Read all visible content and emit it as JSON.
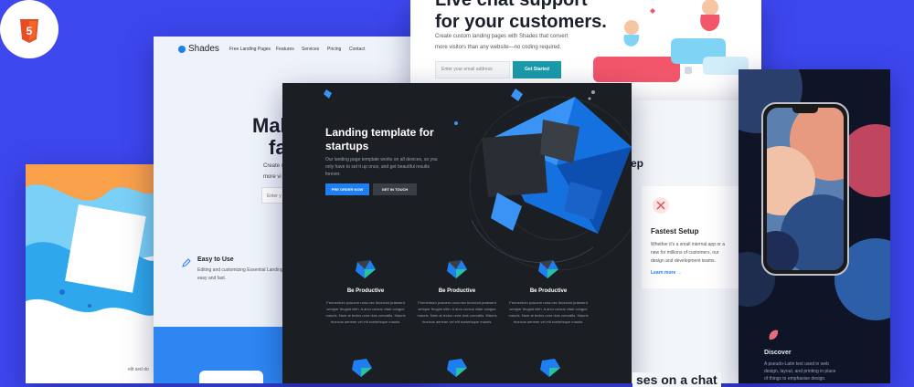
{
  "colors": {
    "background": "#3d47ee",
    "dark_card": "#1b1e23",
    "brand_blue": "#1f7ff2",
    "teal": "#1a9bab"
  },
  "badge": {
    "label": "HTML",
    "number": "5"
  },
  "shades": {
    "brand": "Shades",
    "nav": [
      "Free Landing Pages",
      "Features",
      "Services",
      "Pricing",
      "Contact"
    ],
    "hero_line1": "Mak",
    "hero_line2": "fa",
    "sub_line1": "Create cu",
    "sub_line2": "more vi",
    "email_placeholder": "Enter y",
    "feature_title": "Easy to Use",
    "feature_text": "Editing and customizing Essential Landing is easy and fast."
  },
  "wavy": {
    "text": "elit sed do"
  },
  "chat": {
    "title_line1": "Live chat support",
    "title_line2": "for your customers.",
    "desc_line1": "Create custom landing pages with Shades that convert",
    "desc_line2": "more visitors than any website—no coding required.",
    "email_placeholder": "Enter your email address",
    "cta": "Get Started"
  },
  "mid": {
    "partial_heading": "ep",
    "card_title": "Fastest Setup",
    "card_text": "Whether it's a small internal app or a new for millions of customers, our design and development teams.",
    "link": "Learn more  →"
  },
  "phone": {
    "title": "Discover",
    "text": "A pseudo-Latin text used in web design, layout, and printing in place of things to emphasise design."
  },
  "dark": {
    "title_line1": "Landing template for",
    "title_line2": "startups",
    "body": "Our landing page template works on all devices, so you only have to set it up once, and get beautiful results forever.",
    "btn_primary": "PRE ORDER NOW",
    "btn_secondary": "GET IN TOUCH",
    "features": [
      {
        "title": "Be Productive",
        "text": "Fermentum posuere urna nec tincidunt praesent semper feugiat nibh. A arcu cursus vitae congue mauris. Nam at lectus urna duis convallis. Mauris rhoncus aenean vel elit scelerisque mauris."
      },
      {
        "title": "Be Productive",
        "text": "Fermentum posuere urna nec tincidunt praesent semper feugiat nibh. A arcu cursus vitae congue mauris. Nam at lectus urna duis convallis. Mauris rhoncus aenean vel elit scelerisque mauris."
      },
      {
        "title": "Be Productive",
        "text": "Fermentum posuere urna nec tincidunt praesent semper feugiat nibh. A arcu cursus vitae congue mauris. Nam at lectus urna duis convallis. Mauris rhoncus aenean vel elit scelerisque mauris."
      }
    ]
  },
  "bottom_text": "ses on a chat"
}
